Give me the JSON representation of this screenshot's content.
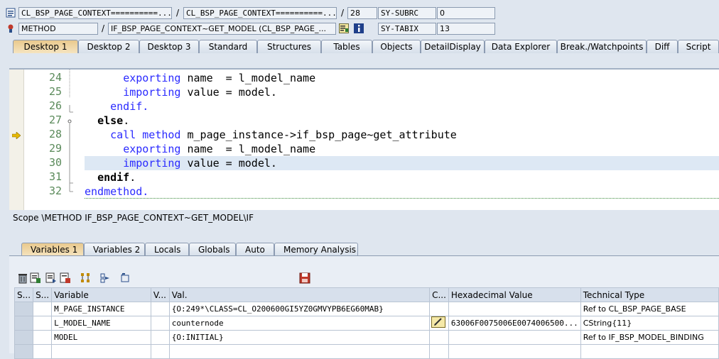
{
  "header": {
    "program": "CL_BSP_PAGE_CONTEXT==========...",
    "include": "CL_BSP_PAGE_CONTEXT==========...",
    "line": "28",
    "subrc_label": "SY-SUBRC",
    "subrc_value": "0",
    "event_type": "METHOD",
    "event": "IF_BSP_PAGE_CONTEXT~GET_MODEL (CL_BSP_PAGE_...",
    "tabix_label": "SY-TABIX",
    "tabix_value": "13",
    "slash": "/"
  },
  "tabs": [
    "Desktop 1",
    "Desktop 2",
    "Desktop 3",
    "Standard",
    "Structures",
    "Tables",
    "Objects",
    "DetailDisplay",
    "Data Explorer",
    "Break./Watchpoints",
    "Diff",
    "Script"
  ],
  "code": {
    "lines": [
      {
        "num": "24",
        "indent": "      ",
        "parts": [
          {
            "t": "exporting",
            "c": "kw"
          },
          {
            "t": " name  = l_model_name",
            "c": ""
          }
        ]
      },
      {
        "num": "25",
        "indent": "      ",
        "parts": [
          {
            "t": "importing",
            "c": "kw"
          },
          {
            "t": " value = model.",
            "c": ""
          }
        ]
      },
      {
        "num": "26",
        "indent": "    ",
        "parts": [
          {
            "t": "endif.",
            "c": "kw"
          }
        ]
      },
      {
        "num": "27",
        "indent": "  ",
        "parts": [
          {
            "t": "else",
            "c": "kwb"
          },
          {
            "t": ".",
            "c": ""
          }
        ]
      },
      {
        "num": "28",
        "indent": "    ",
        "parts": [
          {
            "t": "call method",
            "c": "kw"
          },
          {
            "t": " m_page_instance->if_bsp_page~get_attribute",
            "c": ""
          }
        ]
      },
      {
        "num": "29",
        "indent": "      ",
        "parts": [
          {
            "t": "exporting",
            "c": "kw"
          },
          {
            "t": " name  = l_model_name",
            "c": ""
          }
        ]
      },
      {
        "num": "30",
        "indent": "      ",
        "parts": [
          {
            "t": "importing",
            "c": "kw"
          },
          {
            "t": " value = model.",
            "c": ""
          }
        ]
      },
      {
        "num": "31",
        "indent": "  ",
        "parts": [
          {
            "t": "endif",
            "c": "kwb"
          },
          {
            "t": ".",
            "c": ""
          }
        ]
      },
      {
        "num": "32",
        "indent": "",
        "parts": [
          {
            "t": "endmethod.",
            "c": "kw"
          }
        ]
      }
    ]
  },
  "scope": "Scope \\METHOD IF_BSP_PAGE_CONTEXT~GET_MODEL\\IF",
  "lower_tabs": [
    "Variables 1",
    "Variables 2",
    "Locals",
    "Globals",
    "Auto",
    "Memory Analysis"
  ],
  "grid": {
    "headers": [
      "S...",
      "Variable",
      "V...",
      "Val.",
      "C...",
      "Hexadecimal Value",
      "Technical Type"
    ],
    "rows": [
      {
        "variable": "M_PAGE_INSTANCE",
        "value": "{O:249*\\CLASS=CL_O200600GI5YZ0GMVYPB6EG60MAB}",
        "hex": "",
        "type": "Ref to CL_BSP_PAGE_BASE"
      },
      {
        "variable": "L_MODEL_NAME",
        "value": "counternode",
        "hex": "63006F0075006E0074006500...",
        "type": "CString{11}"
      },
      {
        "variable": "MODEL",
        "value": "{O:INITIAL}",
        "hex": "",
        "type": "Ref to IF_BSP_MODEL_BINDING"
      }
    ]
  }
}
